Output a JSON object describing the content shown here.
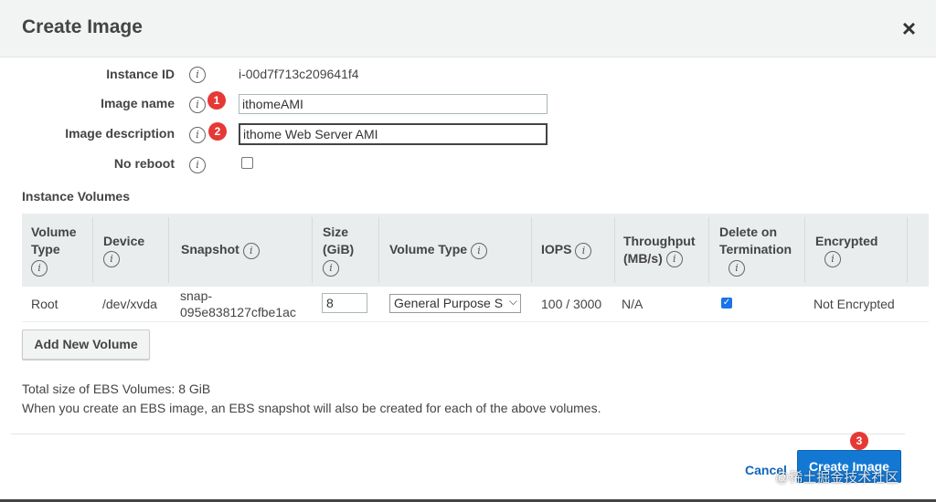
{
  "dialog": {
    "title": "Create Image",
    "close_label": "×"
  },
  "form": {
    "instance_id": {
      "label": "Instance ID",
      "value": "i-00d7f713c209641f4"
    },
    "image_name": {
      "label": "Image name",
      "value": "ithomeAMI",
      "badge": "1"
    },
    "image_description": {
      "label": "Image description",
      "value": "ithome Web Server AMI",
      "badge": "2"
    },
    "no_reboot": {
      "label": "No reboot",
      "checked": false
    },
    "info_glyph": "i"
  },
  "volumes": {
    "section_title": "Instance Volumes",
    "columns": [
      "Volume Type",
      "Device",
      "Snapshot",
      "Size (GiB)",
      "Volume Type",
      "IOPS",
      "Throughput (MB/s)",
      "Delete on Termination",
      "Encrypted"
    ],
    "col_lines": {
      "c0": [
        "Volume",
        "Type"
      ],
      "c3": [
        "Size",
        "(GiB)"
      ],
      "c6": [
        "Throughput",
        "(MB/s)"
      ],
      "c7": [
        "Delete on",
        "Termination"
      ]
    },
    "rows": [
      {
        "volume_type": "Root",
        "device": "/dev/xvda",
        "snapshot_line1": "snap-",
        "snapshot_line2": "095e838127cfbe1ac",
        "size": "8",
        "ebs_type": "General Purpose S",
        "iops": "100 / 3000",
        "throughput": "N/A",
        "delete_on_termination": true,
        "encrypted": "Not Encrypted"
      }
    ],
    "add_button": "Add New Volume"
  },
  "summary": {
    "total": "Total size of EBS Volumes: 8 GiB",
    "note": "When you create an EBS image, an EBS snapshot will also be created for each of the above volumes."
  },
  "footer": {
    "cancel": "Cancel",
    "create": "Create Image",
    "badge": "3",
    "watermark": "@稀土掘金技术社区"
  },
  "colors": {
    "primary": "#1378d3",
    "link": "#1166bb",
    "badge": "#e53935",
    "header_bg": "#f2f3f3",
    "table_header_bg": "#eaeded"
  }
}
